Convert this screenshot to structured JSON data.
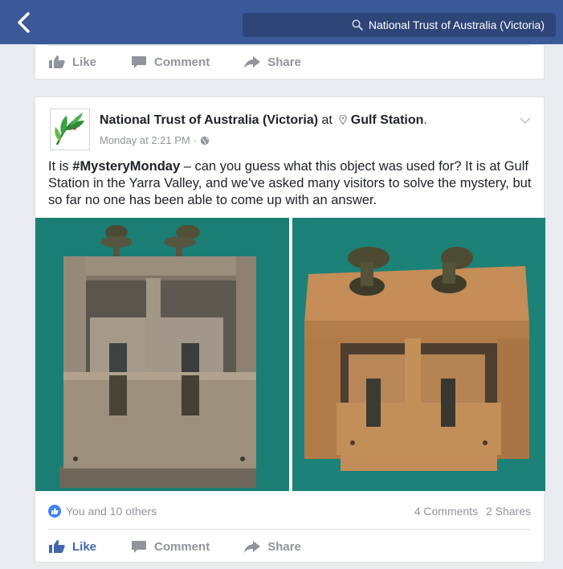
{
  "topbar": {
    "search_text": "National Trust of Australia (Victoria)"
  },
  "prev_post": {
    "actions": {
      "like": "Like",
      "comment": "Comment",
      "share": "Share"
    }
  },
  "post": {
    "page_name": "National Trust of Australia (Victoria)",
    "at_word": "at",
    "location": "Gulf Station",
    "location_suffix": ".",
    "timestamp": "Monday at 2:21 PM",
    "meta_separator": "·",
    "text_prefix": "It is ",
    "hashtag": "#MysteryMonday",
    "text_body": " – can you guess what this object was used for? It is at Gulf Station in the Yarra Valley, and we've asked many visitors to solve the mystery, but so far no one has been able to come up with an answer.",
    "reactions_text": "You and 10 others",
    "comments_count": "4 Comments",
    "shares_count": "2 Shares",
    "actions": {
      "like": "Like",
      "comment": "Comment",
      "share": "Share"
    },
    "like_state": "liked"
  },
  "colors": {
    "brand": "#3b5998",
    "like_blue": "#4267b2",
    "photo_background": "#1d8177"
  }
}
